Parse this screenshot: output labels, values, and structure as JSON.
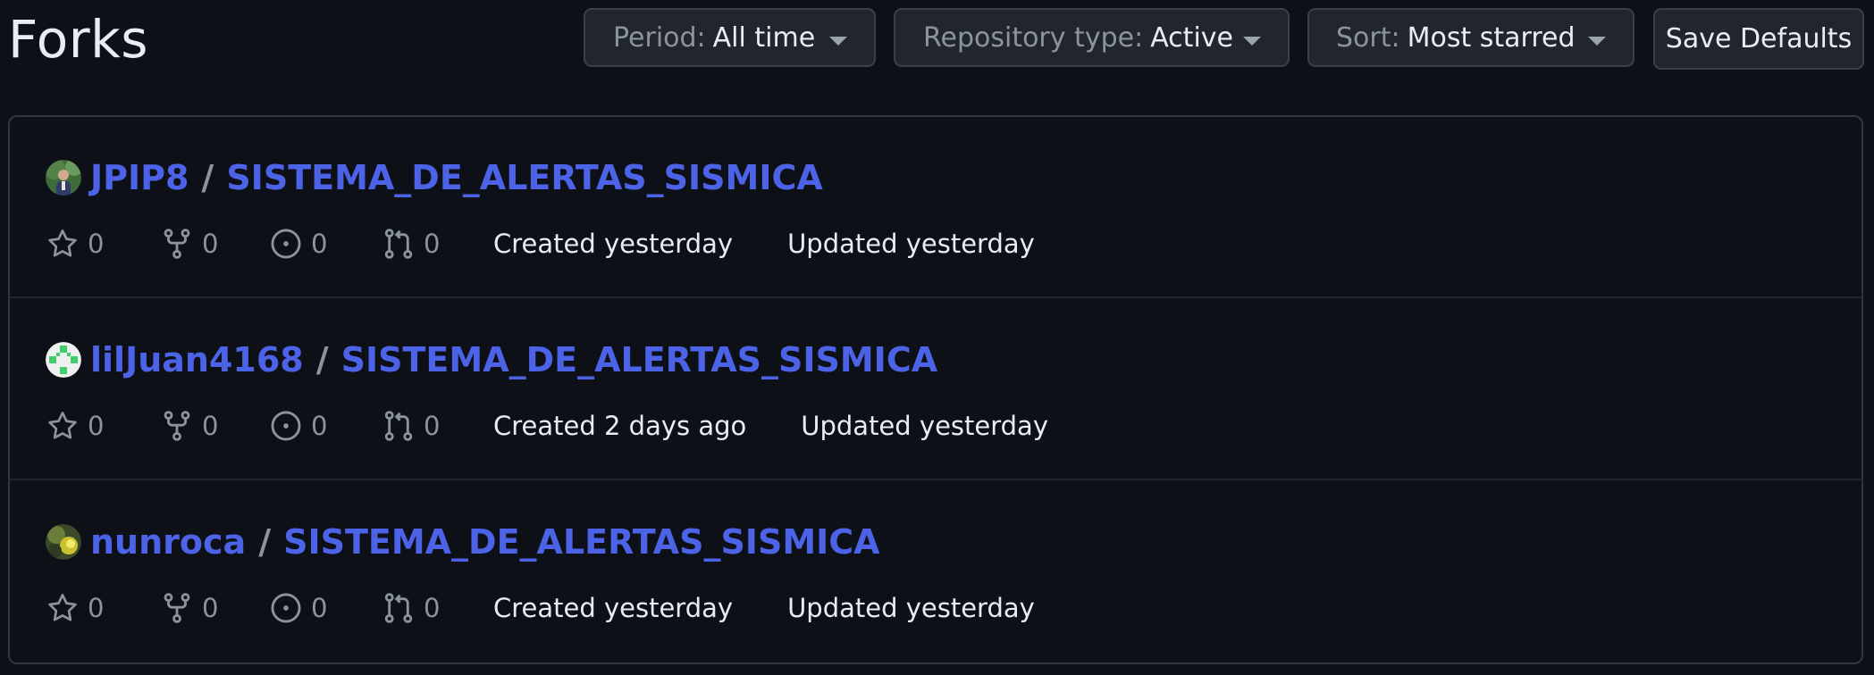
{
  "page": {
    "title": "Forks"
  },
  "filters": {
    "period": {
      "label": "Period:",
      "value": "All time"
    },
    "repository_type": {
      "label": "Repository type:",
      "value": "Active"
    },
    "sort": {
      "label": "Sort:",
      "value": "Most starred"
    },
    "save_label": "Save Defaults"
  },
  "colors": {
    "background": "#0d1117",
    "link": "#4c63e8",
    "muted": "#8b949e",
    "text": "#e6edf3",
    "border": "#30363d"
  },
  "forks": [
    {
      "owner": "JPIP8",
      "separator": "/",
      "repo": "SISTEMA_DE_ALERTAS_SISMICA",
      "avatar": "user-photo-avatar",
      "stars": "0",
      "forks": "0",
      "issues": "0",
      "pull_requests": "0",
      "created": "Created yesterday",
      "updated": "Updated yesterday"
    },
    {
      "owner": "lilJuan4168",
      "separator": "/",
      "repo": "SISTEMA_DE_ALERTAS_SISMICA",
      "avatar": "identicon-avatar",
      "stars": "0",
      "forks": "0",
      "issues": "0",
      "pull_requests": "0",
      "created": "Created 2 days ago",
      "updated": "Updated yesterday"
    },
    {
      "owner": "nunroca",
      "separator": "/",
      "repo": "SISTEMA_DE_ALERTAS_SISMICA",
      "avatar": "user-photo-avatar",
      "stars": "0",
      "forks": "0",
      "issues": "0",
      "pull_requests": "0",
      "created": "Created yesterday",
      "updated": "Updated yesterday"
    }
  ]
}
